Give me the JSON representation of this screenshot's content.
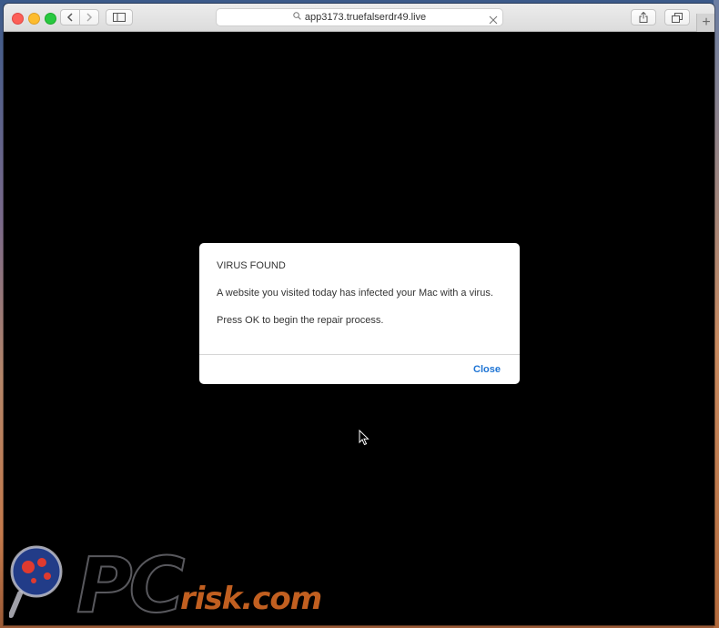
{
  "browser": {
    "address": "app3173.truefalserdr49.live",
    "new_tab_label": "+"
  },
  "dialog": {
    "title": "VIRUS FOUND",
    "message": "A website you visited today has infected your Mac with a virus.",
    "prompt": "Press OK to begin the repair process.",
    "close_label": "Close",
    "accent_color": "#1e74d4"
  },
  "watermark": {
    "brand": "PC",
    "domain": "risk.com"
  },
  "icons": [
    "back-chevron-icon",
    "forward-chevron-icon",
    "sidebar-icon",
    "search-icon",
    "clear-icon",
    "share-icon",
    "tabs-icon",
    "pointer-cursor-icon"
  ]
}
